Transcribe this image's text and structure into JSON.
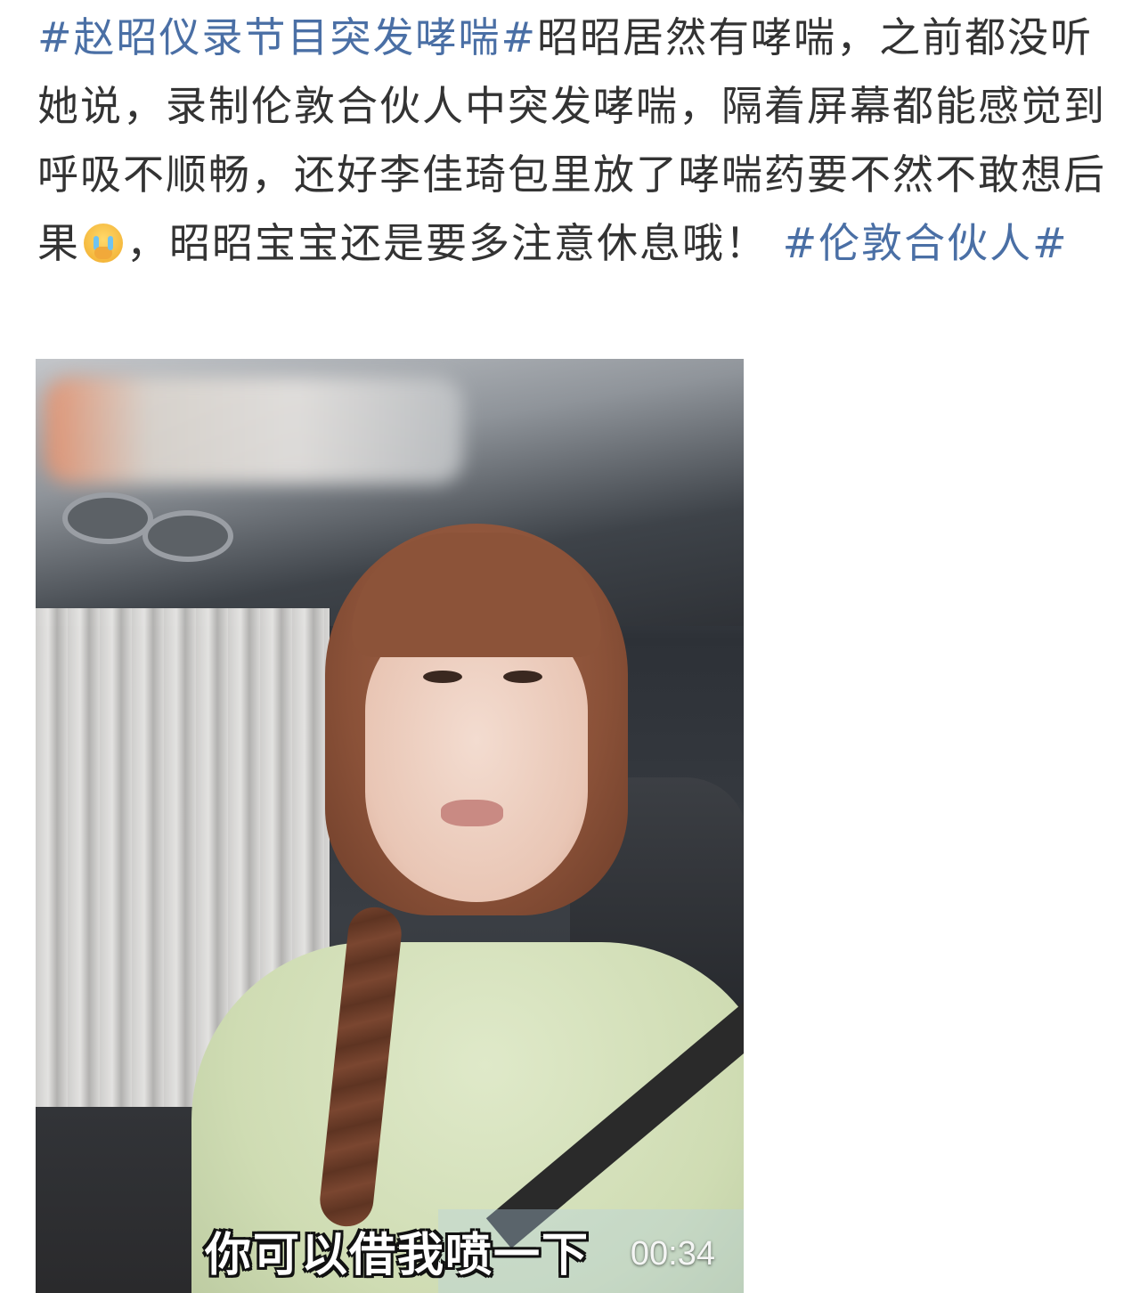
{
  "post": {
    "topic1": "#赵昭仪录节目突发哮喘#",
    "body1": "昭昭居然有哮喘，之前都没听她说，录制伦敦合伙人中突发哮喘，隔着屏幕都能感觉到呼吸不顺畅，还好李佳琦包里放了哮喘药要不然不敢想后果",
    "emoji_name": "crying-covering-mouth-emoji",
    "body2": "，昭昭宝宝还是要多注意休息哦！ ",
    "topic2": "#伦敦合伙人#"
  },
  "video": {
    "subtitle": "你可以借我喷一下",
    "timestamp": "00:34"
  }
}
